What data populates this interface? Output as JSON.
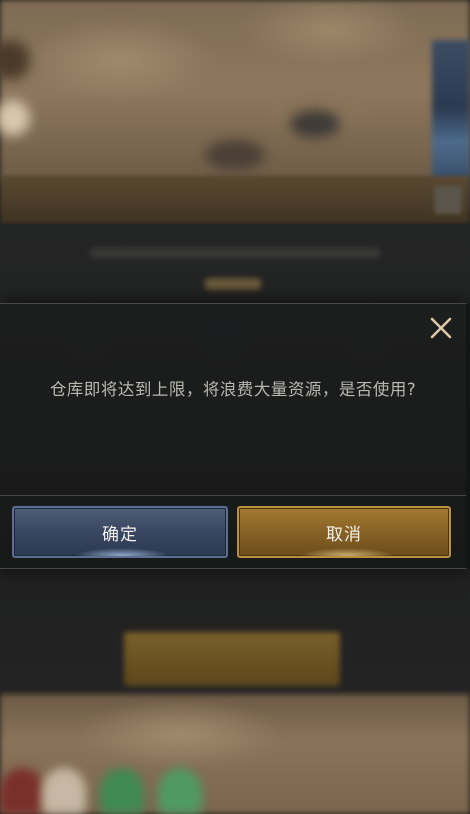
{
  "dialog": {
    "message": "仓库即将达到上限，将浪费大量资源，是否使用?",
    "confirm_label": "确定",
    "cancel_label": "取消"
  },
  "icons": {
    "close": "close-icon"
  },
  "colors": {
    "confirm_button": "#3b4863",
    "cancel_button": "#8a6426",
    "close_icon": "#d9c9a8"
  }
}
